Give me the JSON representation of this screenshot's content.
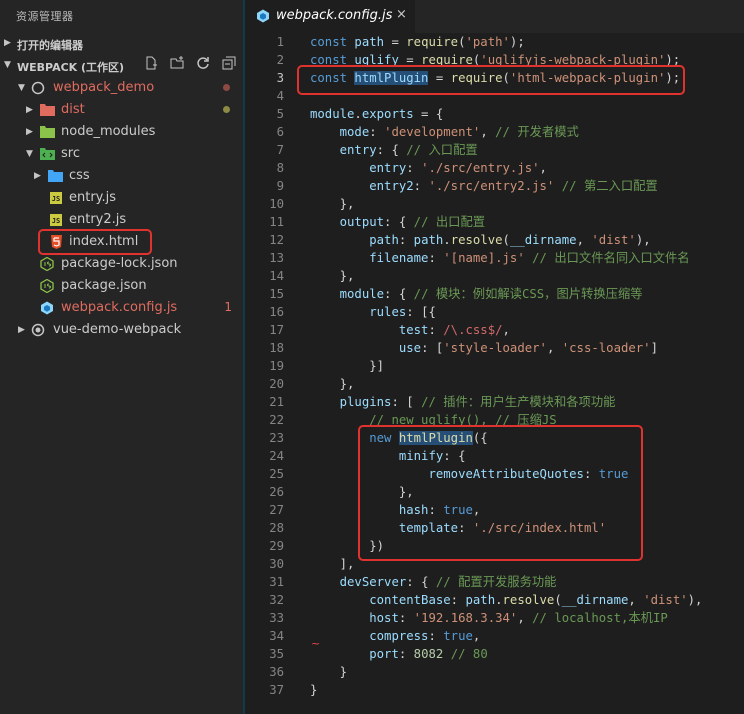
{
  "sidebar": {
    "title": "资源管理器",
    "open_editors_label": "打开的编辑器",
    "workspace_label": "WEBPACK (工作区)",
    "tree": {
      "webpack_demo": "webpack_demo",
      "dist": "dist",
      "node_modules": "node_modules",
      "src": "src",
      "css": "css",
      "entry_js": "entry.js",
      "entry2_js": "entry2.js",
      "index_html": "index.html",
      "package_lock": "package-lock.json",
      "package_json": "package.json",
      "webpack_config": "webpack.config.js",
      "webpack_config_badge": "1",
      "vue_demo": "vue-demo-webpack"
    }
  },
  "editor": {
    "tab": {
      "filename": "webpack.config.js",
      "close_glyph": "×"
    },
    "active_line": 3
  },
  "colors": {
    "error": "#e0332f",
    "folder_blue": "#6ca9d8",
    "js_yellow": "#cbcb41",
    "html_orange": "#e44d26",
    "json_green": "#8bc34a"
  },
  "code": [
    [
      [
        "kw",
        "const "
      ],
      [
        "var",
        "path"
      ],
      [
        "p",
        " = "
      ],
      [
        "fn",
        "require"
      ],
      [
        "p",
        "("
      ],
      [
        "str",
        "'path'"
      ],
      [
        "p",
        ");"
      ]
    ],
    [
      [
        "kw",
        "const "
      ],
      [
        "var",
        "uglify"
      ],
      [
        "p",
        " = "
      ],
      [
        "fn",
        "require"
      ],
      [
        "p",
        "("
      ],
      [
        "str",
        "'uglifyjs-webpack-plugin'"
      ],
      [
        "p",
        ");"
      ]
    ],
    [
      [
        "kw",
        "const "
      ],
      [
        "var hl",
        "htmlPlugin"
      ],
      [
        "p",
        " = "
      ],
      [
        "fn",
        "require"
      ],
      [
        "p",
        "("
      ],
      [
        "str",
        "'html-webpack-plugin'"
      ],
      [
        "p",
        ");"
      ]
    ],
    [],
    [
      [
        "var",
        "module"
      ],
      [
        "p",
        "."
      ],
      [
        "var",
        "exports"
      ],
      [
        "p",
        " = {"
      ]
    ],
    [
      [
        "p",
        "    "
      ],
      [
        "var",
        "mode"
      ],
      [
        "p",
        ": "
      ],
      [
        "str",
        "'development'"
      ],
      [
        "p",
        ", "
      ],
      [
        "cm",
        "// 开发者模式"
      ]
    ],
    [
      [
        "p",
        "    "
      ],
      [
        "var",
        "entry"
      ],
      [
        "p",
        ": { "
      ],
      [
        "cm",
        "// 入口配置"
      ]
    ],
    [
      [
        "p",
        "        "
      ],
      [
        "var",
        "entry"
      ],
      [
        "p",
        ": "
      ],
      [
        "str",
        "'./src/entry.js'"
      ],
      [
        "p",
        ","
      ]
    ],
    [
      [
        "p",
        "        "
      ],
      [
        "var",
        "entry2"
      ],
      [
        "p",
        ": "
      ],
      [
        "str",
        "'./src/entry2.js'"
      ],
      [
        "p",
        " "
      ],
      [
        "cm",
        "// 第二入口配置"
      ]
    ],
    [
      [
        "p",
        "    },"
      ]
    ],
    [
      [
        "p",
        "    "
      ],
      [
        "var",
        "output"
      ],
      [
        "p",
        ": { "
      ],
      [
        "cm",
        "// 出口配置"
      ]
    ],
    [
      [
        "p",
        "        "
      ],
      [
        "var",
        "path"
      ],
      [
        "p",
        ": "
      ],
      [
        "var",
        "path"
      ],
      [
        "p",
        "."
      ],
      [
        "fn",
        "resolve"
      ],
      [
        "p",
        "("
      ],
      [
        "var",
        "__dirname"
      ],
      [
        "p",
        ", "
      ],
      [
        "str",
        "'dist'"
      ],
      [
        "p",
        "),"
      ]
    ],
    [
      [
        "p",
        "        "
      ],
      [
        "var",
        "filename"
      ],
      [
        "p",
        ": "
      ],
      [
        "str",
        "'[name].js'"
      ],
      [
        "p",
        " "
      ],
      [
        "cm",
        "// 出口文件名同入口文件名"
      ]
    ],
    [
      [
        "p",
        "    },"
      ]
    ],
    [
      [
        "p",
        "    "
      ],
      [
        "var",
        "module"
      ],
      [
        "p",
        ": { "
      ],
      [
        "cm",
        "// 模块：例如解读CSS，图片转换压缩等"
      ]
    ],
    [
      [
        "p",
        "        "
      ],
      [
        "var",
        "rules"
      ],
      [
        "p",
        ": [{"
      ]
    ],
    [
      [
        "p",
        "            "
      ],
      [
        "var",
        "test"
      ],
      [
        "p",
        ": "
      ],
      [
        "re",
        "/\\.css$/"
      ],
      [
        "p",
        ","
      ]
    ],
    [
      [
        "p",
        "            "
      ],
      [
        "var",
        "use"
      ],
      [
        "p",
        ": ["
      ],
      [
        "str",
        "'style-loader'"
      ],
      [
        "p",
        ", "
      ],
      [
        "str",
        "'css-loader'"
      ],
      [
        "p",
        "]"
      ]
    ],
    [
      [
        "p",
        "        }]"
      ]
    ],
    [
      [
        "p",
        "    },"
      ]
    ],
    [
      [
        "p",
        "    "
      ],
      [
        "var",
        "plugins"
      ],
      [
        "p",
        ": [ "
      ],
      [
        "cm",
        "// 插件：用户生产模块和各项功能"
      ]
    ],
    [
      [
        "p",
        "        "
      ],
      [
        "cm",
        "// new uglify(), // 压缩JS"
      ]
    ],
    [
      [
        "p",
        "        "
      ],
      [
        "kw",
        "new "
      ],
      [
        "fn hl",
        "htmlPlugin"
      ],
      [
        "p",
        "({"
      ]
    ],
    [
      [
        "p",
        "            "
      ],
      [
        "var",
        "minify"
      ],
      [
        "p",
        ": {"
      ]
    ],
    [
      [
        "p",
        "                "
      ],
      [
        "var",
        "removeAttributeQuotes"
      ],
      [
        "p",
        ": "
      ],
      [
        "kw",
        "true"
      ]
    ],
    [
      [
        "p",
        "            },"
      ]
    ],
    [
      [
        "p",
        "            "
      ],
      [
        "var",
        "hash"
      ],
      [
        "p",
        ": "
      ],
      [
        "kw",
        "true"
      ],
      [
        "p",
        ","
      ]
    ],
    [
      [
        "p",
        "            "
      ],
      [
        "var",
        "template"
      ],
      [
        "p",
        ": "
      ],
      [
        "str",
        "'./src/index.html'"
      ]
    ],
    [
      [
        "p",
        "        })"
      ]
    ],
    [
      [
        "p",
        "    ],"
      ]
    ],
    [
      [
        "p",
        "    "
      ],
      [
        "var",
        "devServer"
      ],
      [
        "p",
        ": { "
      ],
      [
        "cm",
        "// 配置开发服务功能"
      ]
    ],
    [
      [
        "p",
        "        "
      ],
      [
        "var",
        "contentBase"
      ],
      [
        "p",
        ": "
      ],
      [
        "var",
        "path"
      ],
      [
        "p",
        "."
      ],
      [
        "fn",
        "resolve"
      ],
      [
        "p",
        "("
      ],
      [
        "var",
        "__dirname"
      ],
      [
        "p",
        ", "
      ],
      [
        "str",
        "'dist'"
      ],
      [
        "p",
        "),"
      ]
    ],
    [
      [
        "p",
        "        "
      ],
      [
        "var",
        "host"
      ],
      [
        "p",
        ": "
      ],
      [
        "str",
        "'192.168.3.34'"
      ],
      [
        "p",
        ", "
      ],
      [
        "cm",
        "// localhost,本机IP"
      ]
    ],
    [
      [
        "p",
        "        "
      ],
      [
        "var",
        "compress"
      ],
      [
        "p",
        ": "
      ],
      [
        "kw",
        "true"
      ],
      [
        "p",
        ","
      ]
    ],
    [
      [
        "p",
        "        "
      ],
      [
        "var",
        "port"
      ],
      [
        "p",
        ": "
      ],
      [
        "num",
        "8082"
      ],
      [
        "p",
        " "
      ],
      [
        "cm",
        "// 80"
      ]
    ],
    [
      [
        "p",
        "    }"
      ]
    ],
    [
      [
        "p",
        "}"
      ]
    ]
  ]
}
